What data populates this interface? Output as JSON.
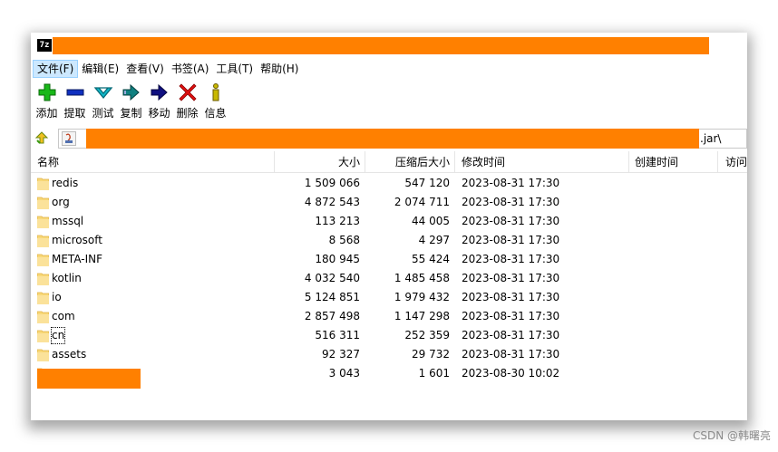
{
  "window": {
    "app_icon_text": "7z",
    "title": ""
  },
  "menu": [
    {
      "label": "文件(F)",
      "active": true
    },
    {
      "label": "编辑(E)",
      "active": false
    },
    {
      "label": "查看(V)",
      "active": false
    },
    {
      "label": "书签(A)",
      "active": false
    },
    {
      "label": "工具(T)",
      "active": false
    },
    {
      "label": "帮助(H)",
      "active": false
    }
  ],
  "toolbar": [
    {
      "label": "添加",
      "icon": "add-icon",
      "color": "#18b818"
    },
    {
      "label": "提取",
      "icon": "extract-icon",
      "color": "#1030c0"
    },
    {
      "label": "测试",
      "icon": "test-icon",
      "color": "#10b8c8"
    },
    {
      "label": "复制",
      "icon": "copy-icon",
      "color": "#108080"
    },
    {
      "label": "移动",
      "icon": "move-icon",
      "color": "#101080"
    },
    {
      "label": "删除",
      "icon": "delete-icon",
      "color": "#e01010"
    },
    {
      "label": "信息",
      "icon": "info-icon",
      "color": "#c8b800"
    }
  ],
  "address": {
    "suffix": ".jar\\"
  },
  "columns": {
    "name": "名称",
    "size": "大小",
    "packed": "压缩后大小",
    "modified": "修改时间",
    "created": "创建时间",
    "accessed": "访问"
  },
  "files": [
    {
      "name": "redis",
      "size": "1 509 066",
      "packed": "547 120",
      "modified": "2023-08-31 17:30"
    },
    {
      "name": "org",
      "size": "4 872 543",
      "packed": "2 074 711",
      "modified": "2023-08-31 17:30"
    },
    {
      "name": "mssql",
      "size": "113 213",
      "packed": "44 005",
      "modified": "2023-08-31 17:30"
    },
    {
      "name": "microsoft",
      "size": "8 568",
      "packed": "4 297",
      "modified": "2023-08-31 17:30"
    },
    {
      "name": "META-INF",
      "size": "180 945",
      "packed": "55 424",
      "modified": "2023-08-31 17:30"
    },
    {
      "name": "kotlin",
      "size": "4 032 540",
      "packed": "1 485 458",
      "modified": "2023-08-31 17:30"
    },
    {
      "name": "io",
      "size": "5 124 851",
      "packed": "1 979 432",
      "modified": "2023-08-31 17:30"
    },
    {
      "name": "com",
      "size": "2 857 498",
      "packed": "1 147 298",
      "modified": "2023-08-31 17:30"
    },
    {
      "name": "cn",
      "size": "516 311",
      "packed": "252 359",
      "modified": "2023-08-31 17:30",
      "focused": true
    },
    {
      "name": "assets",
      "size": "92 327",
      "packed": "29 732",
      "modified": "2023-08-31 17:30"
    },
    {
      "name": "",
      "size": "3 043",
      "packed": "1 601",
      "modified": "2023-08-30 10:02",
      "redacted": true
    }
  ],
  "redaction_color": "#ff8000",
  "watermark": "CSDN @韩曙亮"
}
